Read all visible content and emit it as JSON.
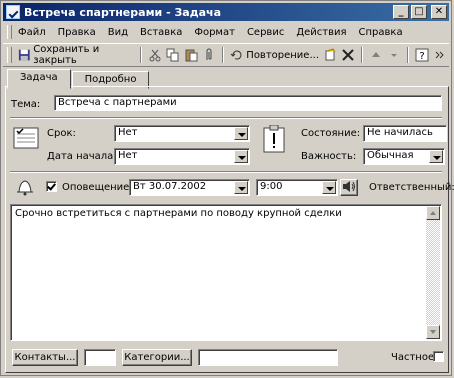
{
  "window": {
    "title": "Встреча спартнерами - Задача"
  },
  "menu": [
    {
      "label": "Файл"
    },
    {
      "label": "Правка"
    },
    {
      "label": "Вид"
    },
    {
      "label": "Вставка"
    },
    {
      "label": "Формат"
    },
    {
      "label": "Сервис"
    },
    {
      "label": "Действия"
    },
    {
      "label": "Справка"
    }
  ],
  "toolbar": {
    "save_close": "Сохранить и закрыть",
    "recurrence": "Повторение..."
  },
  "tabs": [
    {
      "label": "Задача"
    },
    {
      "label": "Подробно"
    }
  ],
  "form": {
    "subject_label": "Тема:",
    "subject_value": "Встреча с партнерами",
    "due_label": "Срок:",
    "due_value": "Нет",
    "start_label": "Дата начала:",
    "start_value": "Нет",
    "status_label": "Состояние:",
    "status_value": "Не начилась",
    "priority_label": "Важность:",
    "priority_value": "Обычная",
    "reminder_label": "Оповещение:",
    "reminder_checked": true,
    "reminder_date": "Вт 30.07.2002",
    "reminder_time": "9:00",
    "owner_label": "Ответственный:",
    "notes": "Срочно встретиться с партнерами по поводу крупной сделки",
    "contacts_button": "Контакты...",
    "categories_button": "Категории...",
    "private_label": "Частное"
  }
}
